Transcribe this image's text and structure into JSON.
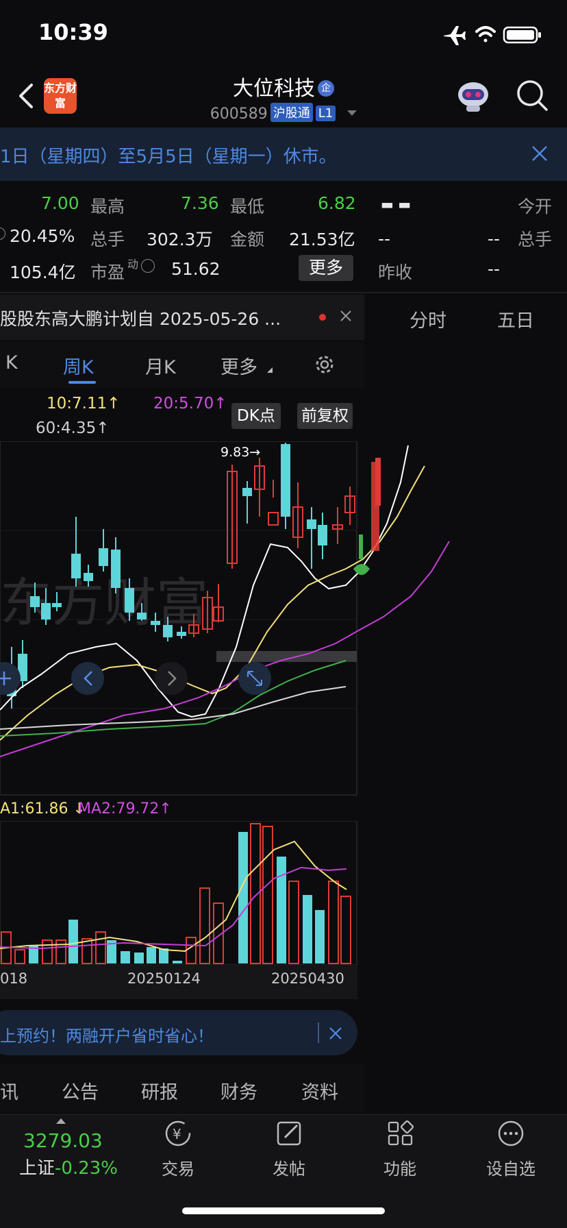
{
  "status": {
    "time": "10:39"
  },
  "header": {
    "logo_text": "东方财富",
    "title": "大位科技",
    "title_badge": "企",
    "code": "600589",
    "tag_connect": "沪股通",
    "tag_level": "L1"
  },
  "notice": {
    "text": "1日（星期四）至5月5日（星期一）休市。"
  },
  "quote": {
    "r1_val1": "7.00",
    "high_label": "最高",
    "high_val": "7.36",
    "low_label": "最低",
    "low_val": "6.82",
    "r2_val1": "20.45%",
    "vol_label": "总手",
    "vol_val": "302.3万",
    "amt_label": "金额",
    "amt_val": "21.53亿",
    "r3_val1": "105.4亿",
    "pe_label": "市盈",
    "pe_sup": "动",
    "pe_val": "51.62",
    "more_button": "更多",
    "right_dash_big": "▬ ▬",
    "right_open_label": "今开",
    "right_r2_a": "--",
    "right_r2_b": "--",
    "right_vol_label": "总手",
    "right_prev_label": "昨收",
    "right_prev_val": "--"
  },
  "news": {
    "text": "股股东高大鹏计划自 2025-05-26 ..."
  },
  "right_tabs": {
    "intraday": "分时",
    "five_day": "五日"
  },
  "period_tabs": {
    "k": "K",
    "weekly": "周K",
    "monthly": "月K",
    "more": "更多"
  },
  "ma_legend": {
    "ma10": "10:7.11",
    "ma10_arrow": "↑",
    "ma20": "20:5.70",
    "ma20_arrow": "↑",
    "ma60": "60:4.35",
    "ma60_arrow": "↑",
    "dk_button": "DK点",
    "adj_button": "前复权"
  },
  "kchart": {
    "peak_label": "9.83→",
    "watermark": "东方财富",
    "colors": {
      "up": "#e03b36",
      "down": "#5ed5d8",
      "ma5": "#ffffff",
      "ma10": "#f5e07a",
      "ma20": "#c33fd4",
      "ma60": "#43b04c",
      "ma120": "#d9d9d9"
    }
  },
  "vol_legend": {
    "ma1": "A1:61.86",
    "ma1_arrow": "↓",
    "ma2": "MA2:79.72",
    "ma2_arrow": "↑"
  },
  "dates": {
    "d1": "018",
    "d2": "20250124",
    "d3": "20250430"
  },
  "ad": {
    "text": "上预约！两融开户省时省心！"
  },
  "info_tabs": {
    "news": "讯",
    "announce": "公告",
    "research": "研报",
    "finance": "财务",
    "profile": "资料"
  },
  "footer": {
    "index_val": "3279.03",
    "index_name": "上证",
    "index_change": "-0.23%",
    "trade": "交易",
    "post": "发帖",
    "functions": "功能",
    "watchlist": "设自选"
  }
}
